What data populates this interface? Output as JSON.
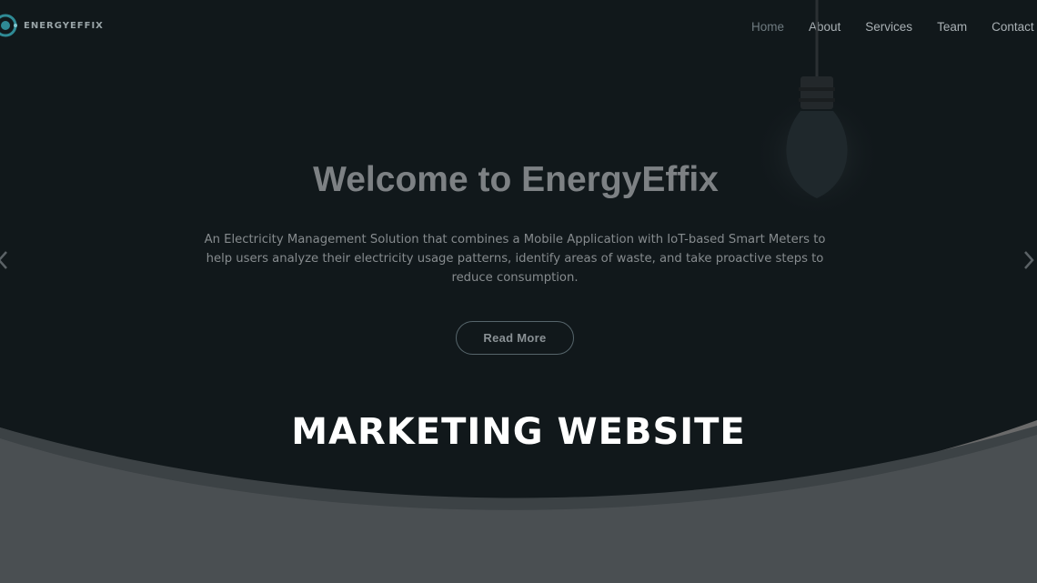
{
  "brand": {
    "name": "ENERGYEFFIX"
  },
  "nav": {
    "items": [
      {
        "label": "Home",
        "active": true
      },
      {
        "label": "About"
      },
      {
        "label": "Services"
      },
      {
        "label": "Team"
      },
      {
        "label": "Contact Us"
      }
    ]
  },
  "hero": {
    "title": "Welcome to EnergyEffix",
    "description": "An Electricity Management Solution that combines a Mobile Application with IoT-based Smart Meters to help users analyze their electricity usage patterns, identify areas of waste, and take proactive steps to reduce consumption.",
    "button_label": "Read More"
  },
  "carousel": {
    "prev_icon": "chevron-left-icon",
    "next_icon": "chevron-right-icon"
  },
  "overlay": {
    "caption": "MARKETING WEBSITE"
  },
  "colors": {
    "hero_bg": "#11181b",
    "wave": "#3f4548",
    "page_bg": "#6a6a6a",
    "accent": "#2f8a95"
  }
}
